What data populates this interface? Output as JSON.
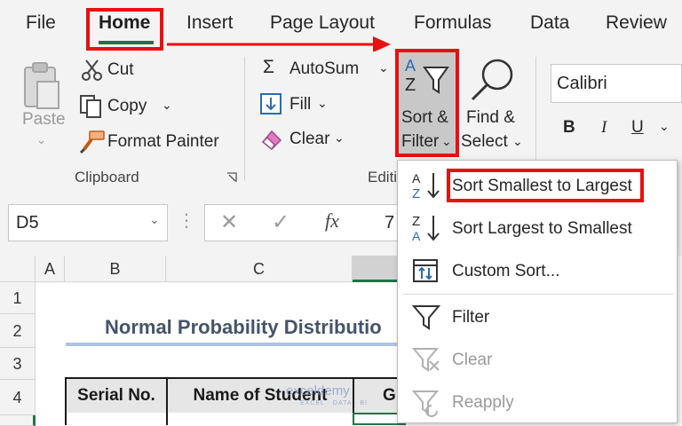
{
  "tabs": {
    "file": "File",
    "home": "Home",
    "insert": "Insert",
    "page_layout": "Page Layout",
    "formulas": "Formulas",
    "data": "Data",
    "review": "Review"
  },
  "clipboard": {
    "paste": "Paste",
    "cut": "Cut",
    "copy": "Copy",
    "format_painter": "Format Painter",
    "group_label": "Clipboard"
  },
  "editing": {
    "autosum": "AutoSum",
    "fill": "Fill",
    "clear": "Clear",
    "group_label_partial": "Editi",
    "sort_filter_line1": "Sort &",
    "sort_filter_line2": "Filter",
    "find_select_line1": "Find &",
    "find_select_line2": "Select"
  },
  "font": {
    "name": "Calibri",
    "bold": "B",
    "italic": "I",
    "underline": "U"
  },
  "formula_bar": {
    "name_box": "D5",
    "fx": "fx",
    "value_partial": "7"
  },
  "columns": [
    "A",
    "B",
    "C"
  ],
  "rows": [
    "1",
    "2",
    "3",
    "4"
  ],
  "sheet": {
    "title": "Normal Probability Distributio",
    "headers": [
      "Serial No.",
      "Name of Student",
      "G"
    ]
  },
  "watermark": {
    "name": "exceldemy",
    "tagline": "EXCEL · DATA · BI"
  },
  "sort_menu": {
    "items": [
      {
        "label": "Sort Smallest to Largest",
        "enabled": true
      },
      {
        "label": "Sort Largest to Smallest",
        "enabled": true
      },
      {
        "label": "Custom Sort...",
        "enabled": true
      },
      {
        "label": "Filter",
        "enabled": true
      },
      {
        "label": "Clear",
        "enabled": false
      },
      {
        "label": "Reapply",
        "enabled": false
      }
    ]
  },
  "colors": {
    "highlight": "#e81010",
    "excel_green": "#217346",
    "ribbon_bg": "#f3f3f3",
    "icon_blue": "#2b6cb0"
  }
}
